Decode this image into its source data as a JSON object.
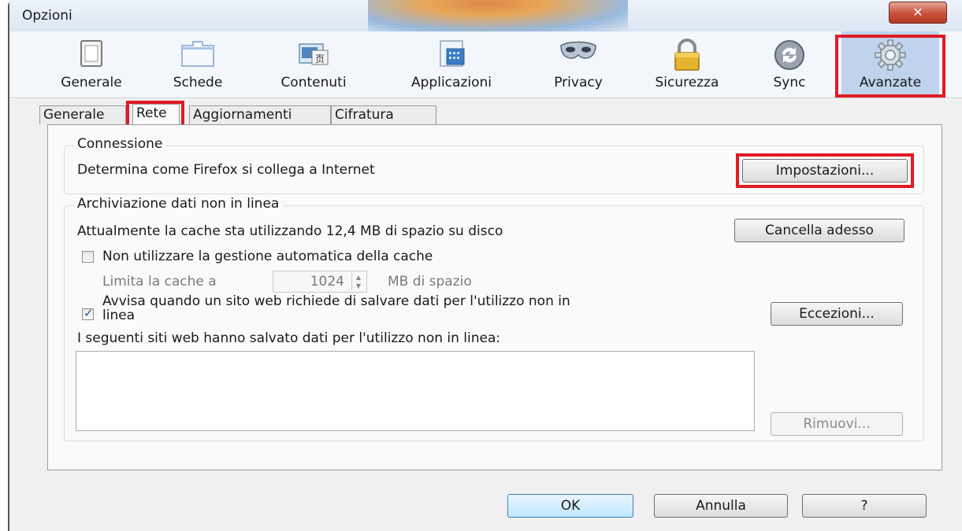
{
  "window": {
    "title": "Opzioni",
    "close_label": "✕"
  },
  "toolbar": {
    "items": [
      {
        "label": "Generale",
        "icon": "switch-icon"
      },
      {
        "label": "Schede",
        "icon": "tabs-icon"
      },
      {
        "label": "Contenuti",
        "icon": "content-icon"
      },
      {
        "label": "Applicazioni",
        "icon": "applications-icon"
      },
      {
        "label": "Privacy",
        "icon": "mask-icon"
      },
      {
        "label": "Sicurezza",
        "icon": "lock-icon"
      },
      {
        "label": "Sync",
        "icon": "sync-icon"
      },
      {
        "label": "Avanzate",
        "icon": "gear-icon"
      }
    ],
    "selected": "Avanzate"
  },
  "subtabs": {
    "items": [
      "Generale",
      "Rete",
      "Aggiornamenti",
      "Cifratura"
    ],
    "selected": "Rete"
  },
  "connection": {
    "legend": "Connessione",
    "description": "Determina come Firefox si collega a Internet",
    "settings_button": "Impostazioni..."
  },
  "offline": {
    "legend": "Archiviazione dati non in linea",
    "cache_usage": "Attualmente la cache sta utilizzando 12,4 MB di spazio su disco",
    "clear_button": "Cancella adesso",
    "override_cache": {
      "label": "Non utilizzare la gestione automatica della cache",
      "checked": false
    },
    "limit": {
      "label": "Limita la cache a",
      "value": "1024",
      "unit": "MB di spazio"
    },
    "warn": {
      "label_line1": "Avvisa quando un sito web richiede di salvare dati per l'utilizzo non in",
      "label_line2": "linea",
      "checked": true
    },
    "exceptions_button": "Eccezioni...",
    "sites_label": "I seguenti siti web hanno salvato dati per l'utilizzo non in linea:",
    "remove_button": "Rimuovi..."
  },
  "footer": {
    "ok": "OK",
    "cancel": "Annulla",
    "help": "?"
  },
  "colors": {
    "highlight": "#e01b24",
    "selected_toolbar": "#bfd3ec"
  }
}
